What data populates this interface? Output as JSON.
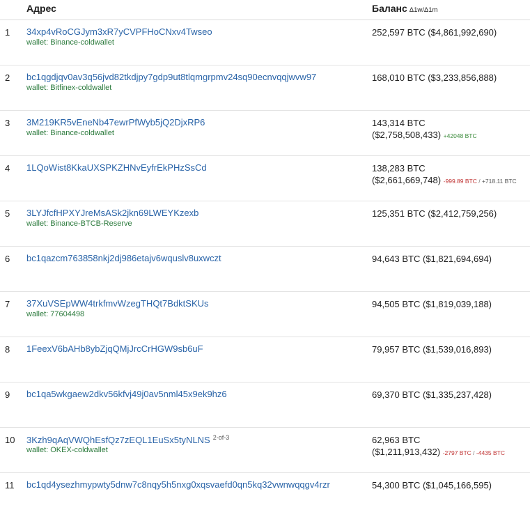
{
  "header": {
    "address_label": "Адрес",
    "balance_label": "Баланс",
    "delta_label": "Δ1w/Δ1m"
  },
  "rows": [
    {
      "rank": "1",
      "address": "34xp4vRoCGJym3xR7yCVPFHoCNxv4Twseo",
      "wallet": "wallet: Binance-coldwallet",
      "balance": "252,597 BTC ($4,861,992,690)"
    },
    {
      "rank": "2",
      "address": "bc1qgdjqv0av3q56jvd82tkdjpy7gdp9ut8tlqmgrpmv24sq90ecnvqqjwvw97",
      "wallet": "wallet: Bitfinex-coldwallet",
      "balance": "168,010 BTC ($3,233,856,888)"
    },
    {
      "rank": "3",
      "address": "3M219KR5vEneNb47ewrPfWyb5jQ2DjxRP6",
      "wallet": "wallet: Binance-coldwallet",
      "balance_line1": "143,314 BTC",
      "balance_line2": "($2,758,508,433)",
      "change_1w": "+42048 BTC"
    },
    {
      "rank": "4",
      "address": "1LQoWist8KkaUXSPKZHNvEyfrEkPHzSsCd",
      "balance_line1": "138,283 BTC",
      "balance_line2": "($2,661,669,748)",
      "change_1w": "-999.89 BTC",
      "change_sep": " / ",
      "change_1m": "+718.11 BTC"
    },
    {
      "rank": "5",
      "address": "3LYJfcfHPXYJreMsASk2jkn69LWEYKzexb",
      "wallet": "wallet: Binance-BTCB-Reserve",
      "balance": "125,351 BTC ($2,412,759,256)"
    },
    {
      "rank": "6",
      "address": "bc1qazcm763858nkj2dj986etajv6wquslv8uxwczt",
      "balance": "94,643 BTC ($1,821,694,694)"
    },
    {
      "rank": "7",
      "address": "37XuVSEpWW4trkfmvWzegTHQt7BdktSKUs",
      "wallet": "wallet: 77604498",
      "balance": "94,505 BTC ($1,819,039,188)"
    },
    {
      "rank": "8",
      "address": "1FeexV6bAHb8ybZjqQMjJrcCrHGW9sb6uF",
      "balance": "79,957 BTC ($1,539,016,893)"
    },
    {
      "rank": "9",
      "address": "bc1qa5wkgaew2dkv56kfvj49j0av5nml45x9ek9hz6",
      "balance": "69,370 BTC ($1,335,237,428)"
    },
    {
      "rank": "10",
      "address": "3Kzh9qAqVWQhEsfQz7zEQL1EuSx5tyNLNS",
      "address_sup": "2-of-3",
      "wallet": "wallet: OKEX-coldwallet",
      "balance_line1": "62,963 BTC",
      "balance_line2": "($1,211,913,432)",
      "change_1w": "-2797 BTC",
      "change_sep": " / ",
      "change_1m": "-4435 BTC"
    },
    {
      "rank": "11",
      "address": "bc1qd4ysezhmypwty5dnw7c8nqy5h5nxg0xqsvaefd0qn5kq32vwnwqqgv4rzr",
      "balance": "54,300 BTC ($1,045,166,595)"
    }
  ]
}
